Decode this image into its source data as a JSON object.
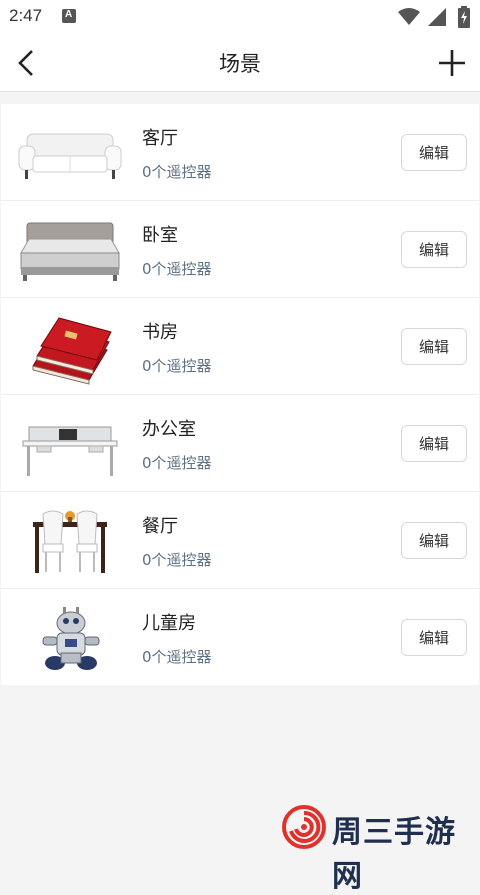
{
  "status_bar": {
    "time": "2:47",
    "notification_icon": "text-a-icon"
  },
  "app_bar": {
    "title": "场景",
    "back_icon": "chevron-left-icon",
    "add_icon": "plus-icon"
  },
  "scenes": [
    {
      "name": "客厅",
      "count_text": "0个遥控器",
      "edit_label": "编辑",
      "image": "sofa-image"
    },
    {
      "name": "卧室",
      "count_text": "0个遥控器",
      "edit_label": "编辑",
      "image": "bed-image"
    },
    {
      "name": "书房",
      "count_text": "0个遥控器",
      "edit_label": "编辑",
      "image": "books-image"
    },
    {
      "name": "办公室",
      "count_text": "0个遥控器",
      "edit_label": "编辑",
      "image": "office-desk-image"
    },
    {
      "name": "餐厅",
      "count_text": "0个遥控器",
      "edit_label": "编辑",
      "image": "dining-table-image"
    },
    {
      "name": "儿童房",
      "count_text": "0个遥控器",
      "edit_label": "编辑",
      "image": "toy-robot-image"
    }
  ],
  "watermark": {
    "text": "周三手游网"
  },
  "colors": {
    "count_text": "#5d7185",
    "watermark_text": "#1f2f4f",
    "watermark_logo": "#e0322d"
  }
}
